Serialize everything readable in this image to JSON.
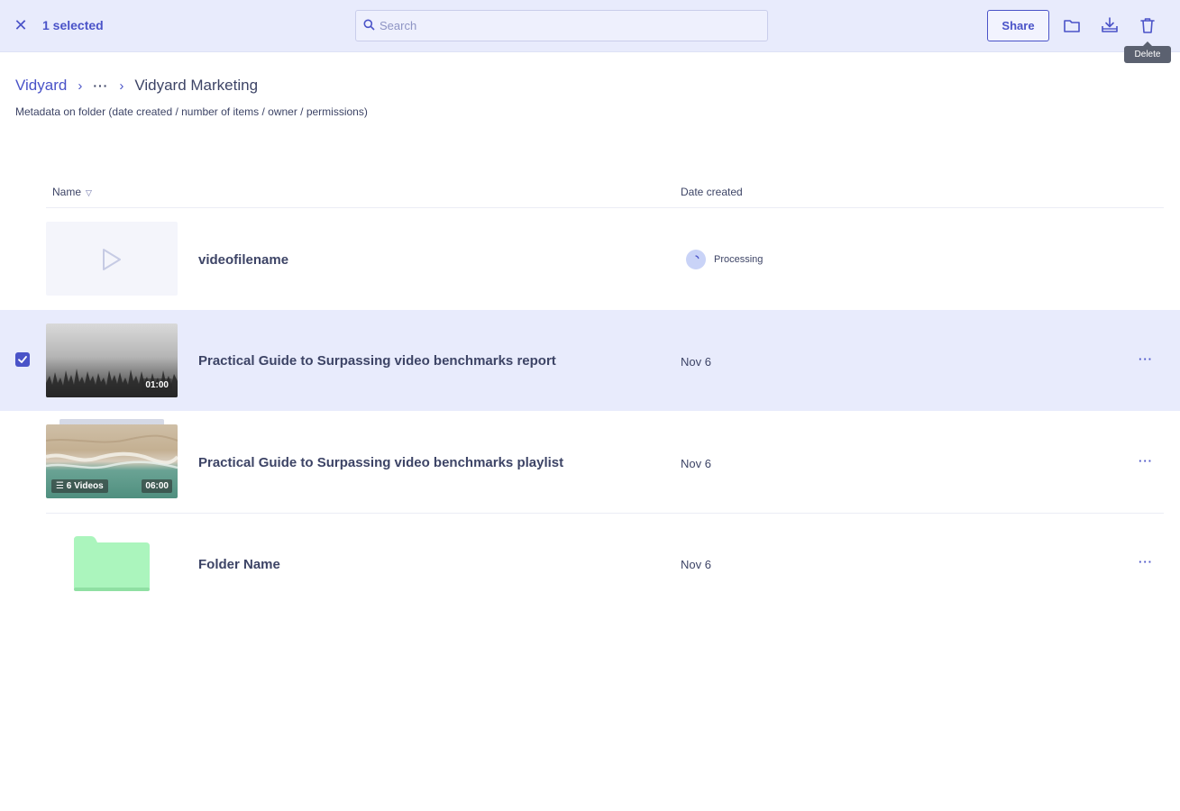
{
  "topbar": {
    "selected_label": "1 selected",
    "search_placeholder": "Search",
    "share_label": "Share",
    "tooltip": "Delete"
  },
  "breadcrumb": {
    "root": "Vidyard",
    "ellipsis": "···",
    "current": "Vidyard Marketing"
  },
  "meta": "Metadata on folder (date created / number of items / owner / permissions)",
  "table": {
    "col_name": "Name",
    "col_date": "Date created"
  },
  "rows": [
    {
      "title": "videofilename",
      "status": "Processing",
      "kind": "video-placeholder"
    },
    {
      "title": "Practical Guide to Surpassing video benchmarks report",
      "date": "Nov 6",
      "duration": "01:00",
      "kind": "video",
      "selected": true
    },
    {
      "title": "Practical Guide to Surpassing video benchmarks playlist",
      "date": "Nov 6",
      "duration": "06:00",
      "count": "6 Videos",
      "kind": "playlist"
    },
    {
      "title": "Folder Name",
      "date": "Nov 6",
      "kind": "folder"
    }
  ],
  "colors": {
    "accent": "#4a53c8",
    "selection_bg": "#e8ebfc",
    "folder": "#abf5bd"
  }
}
